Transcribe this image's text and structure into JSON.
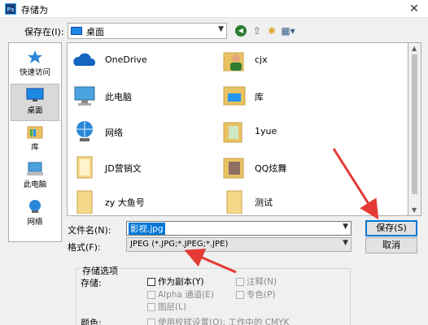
{
  "window": {
    "title": "存储为",
    "app_icon": "Ps",
    "close_glyph": "✕"
  },
  "save_in": {
    "label": "保存在(I):",
    "value": "桌面"
  },
  "toolbar": {
    "back_glyph": "◀",
    "up_glyph": "⇧",
    "newfolder_glyph": "✱",
    "view_glyph": "▦▾"
  },
  "places": [
    {
      "label": "快速访问",
      "icon": "star-icon"
    },
    {
      "label": "桌面",
      "icon": "desktop-icon",
      "selected": true
    },
    {
      "label": "库",
      "icon": "library-icon"
    },
    {
      "label": "此电脑",
      "icon": "computer-icon"
    },
    {
      "label": "网络",
      "icon": "network-icon"
    }
  ],
  "files": [
    {
      "name": "OneDrive",
      "icon": "onedrive-icon"
    },
    {
      "name": "cjx",
      "icon": "user-folder-icon"
    },
    {
      "name": "此电脑",
      "icon": "computer-icon"
    },
    {
      "name": "库",
      "icon": "library-icon"
    },
    {
      "name": "网络",
      "icon": "network-icon"
    },
    {
      "name": "1yue",
      "icon": "folder-icon"
    },
    {
      "name": "JD营销文",
      "icon": "folder-icon"
    },
    {
      "name": "QQ炫舞",
      "icon": "folder-icon"
    },
    {
      "name": "zy 大鱼号",
      "icon": "folder-icon"
    },
    {
      "name": "测试",
      "icon": "folder-icon"
    }
  ],
  "filename": {
    "label": "文件名(N):",
    "value": "影视.jpg"
  },
  "format": {
    "label": "格式(F):",
    "value": "JPEG (*.JPG;*.JPEG;*.JPE)"
  },
  "buttons": {
    "save": "保存(S)",
    "cancel": "取消"
  },
  "options": {
    "title": "存储选项",
    "store_label": "存储:",
    "color_label": "颜色:",
    "checkboxes": [
      {
        "label": "作为副本(Y)",
        "enabled": true
      },
      {
        "label": "注释(N)",
        "enabled": false
      },
      {
        "label": "Alpha 通道(E)",
        "enabled": false
      },
      {
        "label": "专色(P)",
        "enabled": false
      },
      {
        "label": "图层(L)",
        "enabled": false
      },
      {
        "label": "使用校样设置(O):  工作中的 CMYK",
        "enabled": false
      }
    ]
  },
  "colors": {
    "accent": "#0078d7",
    "annotation_arrow": "#e53935"
  }
}
